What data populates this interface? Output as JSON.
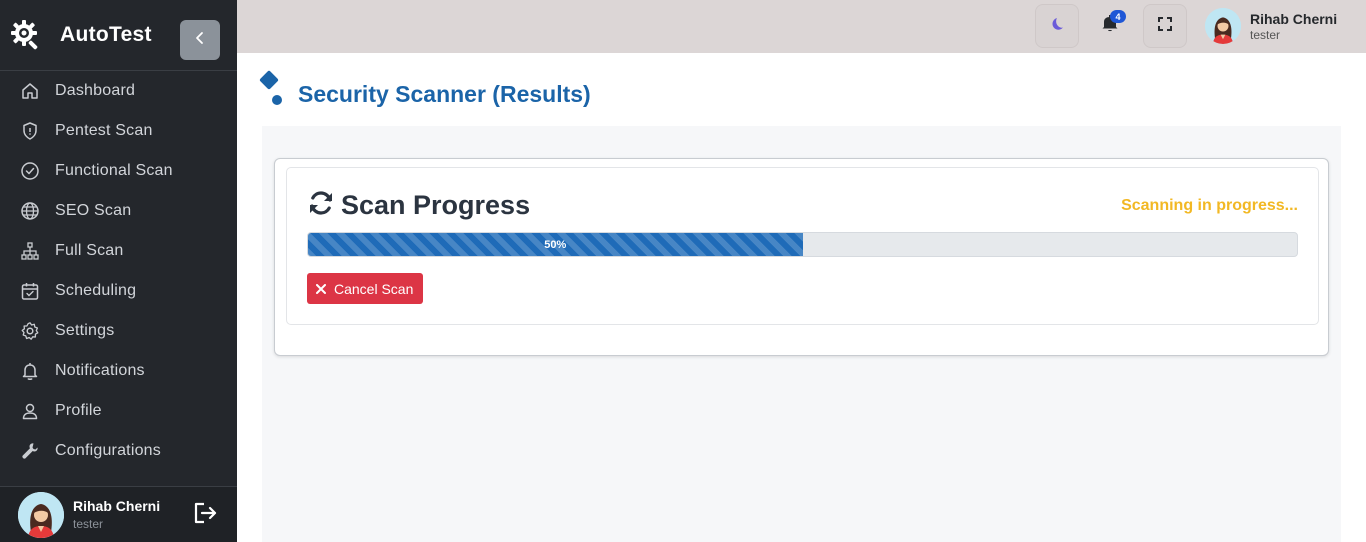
{
  "app": {
    "name": "AutoTest",
    "collapse_icon": "chevron-left-icon"
  },
  "sidebar": {
    "items": [
      {
        "label": "Dashboard",
        "icon": "home-icon"
      },
      {
        "label": "Pentest Scan",
        "icon": "shield-icon"
      },
      {
        "label": "Functional Scan",
        "icon": "check-circle-icon"
      },
      {
        "label": "SEO Scan",
        "icon": "globe-icon"
      },
      {
        "label": "Full Scan",
        "icon": "sitemap-icon"
      },
      {
        "label": "Scheduling",
        "icon": "calendar-check-icon"
      },
      {
        "label": "Settings",
        "icon": "gear-icon"
      },
      {
        "label": "Notifications",
        "icon": "bell-icon"
      },
      {
        "label": "Profile",
        "icon": "user-icon"
      },
      {
        "label": "Configurations",
        "icon": "wrench-icon"
      }
    ],
    "user": {
      "name": "Rihab Cherni",
      "role": "tester"
    }
  },
  "header": {
    "notifications_count": "4",
    "user": {
      "name": "Rihab Cherni",
      "role": "tester"
    }
  },
  "main": {
    "page_title": "Security Scanner (Results)",
    "scan": {
      "title": "Scan Progress",
      "status": "Scanning in progress...",
      "progress_percent": 50,
      "progress_label": "50%",
      "cancel_label": "Cancel Scan"
    }
  },
  "colors": {
    "sidebar_bg": "#24272c",
    "accent": "#1b64a8",
    "status": "#f2b824",
    "danger": "#dc3545",
    "progress": "#1f6bb8"
  }
}
